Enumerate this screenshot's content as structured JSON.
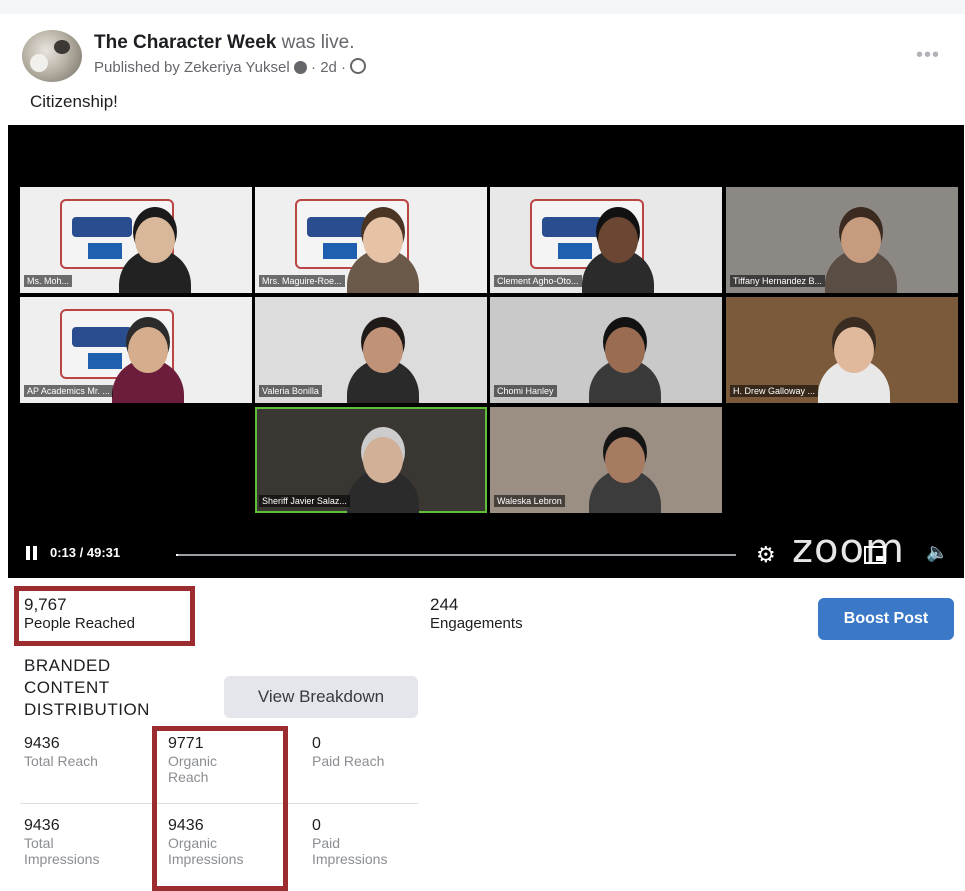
{
  "post": {
    "page_name": "The Character Week",
    "live_text": "was live.",
    "meta": "Published by Zekeriya Yuksel",
    "time_ago": "2d",
    "caption": "Citizenship!",
    "more_label": "•••"
  },
  "video": {
    "participants": [
      {
        "name": "Ms. Moh...",
        "skin": "#d9b79a",
        "hair": "#1a1a1a",
        "shirt": "#222",
        "bg": "#efefef",
        "logo": true
      },
      {
        "name": "Mrs. Maguire-Roe...",
        "skin": "#e6c3a6",
        "hair": "#4a3524",
        "shirt": "#6b5a4a",
        "bg": "#efefef",
        "logo": true
      },
      {
        "name": "Clement Agho-Oto...",
        "skin": "#6b4632",
        "hair": "#111",
        "shirt": "#2b2b2b",
        "bg": "#e8e8e8",
        "logo": true
      },
      {
        "name": "Tiffany Hernandez B...",
        "skin": "#c79c7e",
        "hair": "#3a2a20",
        "shirt": "#5a4d44",
        "bg": "#8c8883",
        "logo": false
      },
      {
        "name": "AP Academics Mr. ...",
        "skin": "#d6ad8d",
        "hair": "#2b2b2b",
        "shirt": "#6d1d3c",
        "bg": "#efefef",
        "logo": true
      },
      {
        "name": "Valeria Bonilla",
        "skin": "#c09378",
        "hair": "#1f1a18",
        "shirt": "#2a2a2a",
        "bg": "#dcdcdc",
        "logo": false
      },
      {
        "name": "Chomi Hanley",
        "skin": "#9a6c52",
        "hair": "#121212",
        "shirt": "#3a3a3a",
        "bg": "#c9c9c9",
        "logo": false
      },
      {
        "name": "H. Drew Galloway ...",
        "skin": "#e0b89b",
        "hair": "#3b2c22",
        "shirt": "#e8e8e8",
        "bg": "#7a5a3a",
        "logo": false
      },
      {
        "name": "Sheriff Javier Salaz...",
        "skin": "#d1b097",
        "hair": "#cccccc",
        "shirt": "#2b2b2b",
        "bg": "#3a3631",
        "logo": false
      },
      {
        "name": "Waleska Lebron",
        "skin": "#a77b62",
        "hair": "#151515",
        "shirt": "#3c3c3c",
        "bg": "#9b8f83",
        "logo": false
      }
    ],
    "current_time": "0:13",
    "duration": "49:31",
    "progress": 0.004,
    "brand_label": "zoom"
  },
  "insights": {
    "people_reached": {
      "value": "9,767",
      "label": "People Reached"
    },
    "engagements": {
      "value": "244",
      "label": "Engagements"
    },
    "boost_label": "Boost Post",
    "branded_lines": [
      "BRANDED",
      "CONTENT",
      "DISTRIBUTION"
    ],
    "view_breakdown_label": "View Breakdown",
    "reach": [
      {
        "value": "9436",
        "label": [
          "Total Reach"
        ]
      },
      {
        "value": "9771",
        "label": [
          "Organic",
          "Reach"
        ]
      },
      {
        "value": "0",
        "label": [
          "Paid Reach"
        ]
      }
    ],
    "impressions": [
      {
        "value": "9436",
        "label": [
          "Total",
          "Impressions"
        ]
      },
      {
        "value": "9436",
        "label": [
          "Organic",
          "Impressions"
        ]
      },
      {
        "value": "0",
        "label": [
          "Paid",
          "Impressions"
        ]
      }
    ]
  }
}
